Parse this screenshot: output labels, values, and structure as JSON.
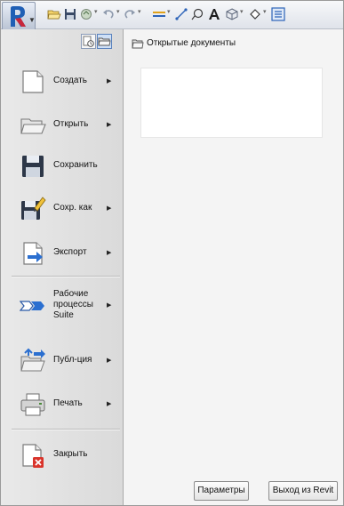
{
  "menu": {
    "items": [
      {
        "id": "create",
        "label": "Создать",
        "submenu": true
      },
      {
        "id": "open",
        "label": "Открыть",
        "submenu": true
      },
      {
        "id": "save",
        "label": "Сохранить",
        "submenu": false
      },
      {
        "id": "save_as",
        "label": "Сохр. как",
        "submenu": true
      },
      {
        "id": "export",
        "label": "Экспорт",
        "submenu": true
      },
      {
        "id": "suite_workflows",
        "label": "Рабочие процессы Suite",
        "submenu": true
      },
      {
        "id": "publish",
        "label": "Публ-ция",
        "submenu": true
      },
      {
        "id": "print",
        "label": "Печать",
        "submenu": true
      },
      {
        "id": "close",
        "label": "Закрыть",
        "submenu": false
      }
    ]
  },
  "documents": {
    "header": "Открытые документы",
    "items": []
  },
  "footer": {
    "options_label": "Параметры",
    "exit_label": "Выход из Revit"
  },
  "colors": {
    "accent": "#1f5fb5",
    "close_badge": "#d9342b"
  }
}
